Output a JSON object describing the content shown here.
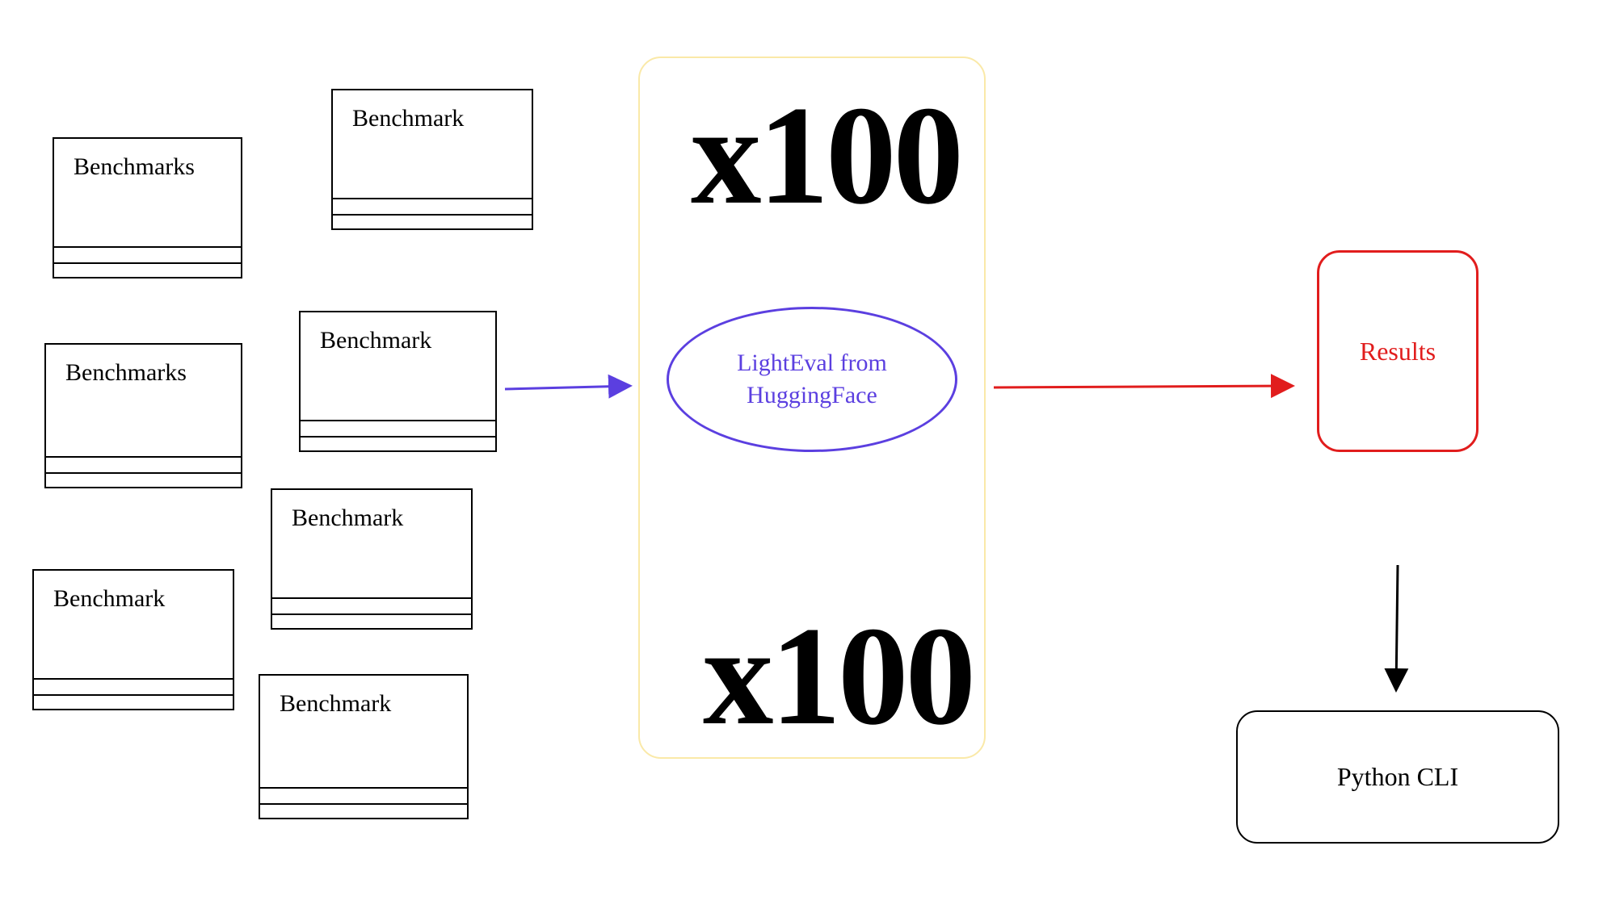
{
  "boxes": {
    "b1": "Benchmarks",
    "b2": "Benchmark",
    "b3": "Benchmarks",
    "b4": "Benchmark",
    "b5": "Benchmark",
    "b6": "Benchmark",
    "b7": "Benchmark"
  },
  "center": {
    "label": "LightEval from HuggingFace"
  },
  "multiplier_top": "x100",
  "multiplier_bottom": "x100",
  "results_label": "Results",
  "cli_label": "Python CLI",
  "colors": {
    "purple": "#5b3fe0",
    "red": "#e11d1d",
    "black": "#000000",
    "faint": "#fae9a8"
  }
}
